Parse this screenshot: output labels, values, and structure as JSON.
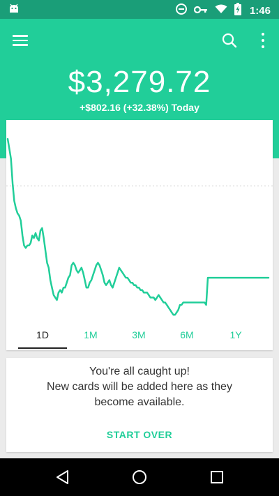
{
  "status_bar": {
    "time": "1:46",
    "icons": [
      "android-icon",
      "do-not-disturb-icon",
      "key-icon",
      "wifi-icon",
      "battery-charging-icon"
    ]
  },
  "header": {
    "menu_icon": "menu-icon",
    "search_icon": "search-icon",
    "more_icon": "more-vert-icon",
    "balance": "$3,279.72",
    "change": "+$802.16 (+32.38%) Today"
  },
  "colors": {
    "brand": "#21ce99",
    "status_bar": "#1a9e78",
    "line": "#21ce99",
    "text_dark": "#222222"
  },
  "chart_data": {
    "type": "line",
    "title": "",
    "xlabel": "",
    "ylabel": "",
    "grid": false,
    "baseline": "dashed reference line",
    "series": [
      {
        "values": [
          100,
          96,
          92,
          82,
          75,
          72,
          70,
          69,
          67,
          61,
          57,
          56,
          57,
          57,
          58,
          61,
          60,
          62,
          60,
          59,
          63,
          64,
          60,
          55,
          50,
          48,
          43,
          40,
          37,
          36,
          35,
          38,
          39,
          38,
          40,
          40,
          42,
          44,
          45,
          49,
          50,
          49,
          47,
          46,
          47,
          48,
          46,
          43,
          40,
          40,
          42,
          43,
          45,
          47,
          49,
          50,
          49,
          47,
          45,
          42,
          41,
          42,
          43,
          41,
          40,
          42,
          44,
          46,
          48,
          47,
          46,
          45,
          44,
          44,
          43,
          42,
          42,
          41,
          41,
          40,
          40,
          39,
          39,
          38,
          38,
          38,
          37,
          36,
          36,
          36,
          35,
          36,
          37,
          36,
          35,
          34,
          34,
          33,
          32,
          31,
          30,
          29,
          29,
          30,
          31,
          33,
          33,
          34,
          34,
          34,
          34,
          34,
          34,
          34,
          34,
          34,
          34,
          34,
          34,
          34,
          34,
          33,
          44,
          44,
          44,
          44,
          44,
          44,
          44,
          44,
          44,
          44,
          44,
          44,
          44,
          44,
          44,
          44,
          44,
          44,
          44,
          44,
          44,
          44,
          44,
          44,
          44,
          44,
          44,
          44,
          44,
          44,
          44,
          44,
          44,
          44,
          44,
          44,
          44,
          44
        ]
      }
    ],
    "ylim": [
      26,
      102
    ],
    "reference_value": 81
  },
  "tabs": [
    {
      "label": "1D",
      "active": true
    },
    {
      "label": "1M",
      "active": false
    },
    {
      "label": "3M",
      "active": false
    },
    {
      "label": "6M",
      "active": false
    },
    {
      "label": "1Y",
      "active": false
    }
  ],
  "news_card": {
    "line1": "You're all caught up!",
    "line2": "New cards will be added here as they",
    "line3": "become available.",
    "start_over": "START OVER"
  },
  "nav_bar": {
    "back_icon": "back-icon",
    "home_icon": "home-icon",
    "recents_icon": "recents-icon"
  }
}
